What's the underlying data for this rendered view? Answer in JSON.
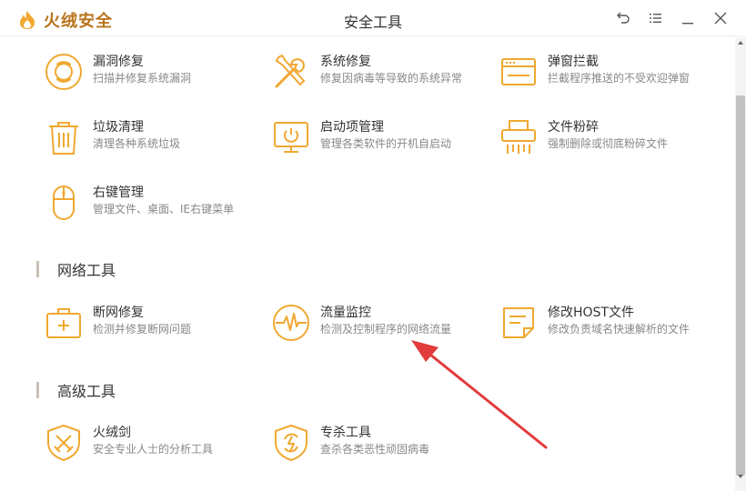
{
  "app": {
    "brand_name": "火绒安全",
    "window_title": "安全工具"
  },
  "colors": {
    "accent": "#f0a830",
    "brand": "#b8741a",
    "annotation_arrow": "#e23b3b"
  },
  "window_controls": [
    {
      "icon": "back-icon"
    },
    {
      "icon": "menu-icon"
    },
    {
      "icon": "minimize-icon"
    },
    {
      "icon": "close-icon"
    }
  ],
  "system_tools": [
    {
      "icon": "lifebuoy-icon",
      "name": "漏洞修复",
      "desc": "扫描并修复系统漏洞"
    },
    {
      "icon": "wrench-screwdriver-icon",
      "name": "系统修复",
      "desc": "修复因病毒等导致的系统异常"
    },
    {
      "icon": "popup-window-icon",
      "name": "弹窗拦截",
      "desc": "拦截程序推送的不受欢迎弹窗"
    },
    {
      "icon": "trash-icon",
      "name": "垃圾清理",
      "desc": "清理各种系统垃圾"
    },
    {
      "icon": "monitor-power-icon",
      "name": "启动项管理",
      "desc": "管理各类软件的开机自启动"
    },
    {
      "icon": "shredder-icon",
      "name": "文件粉碎",
      "desc": "强制删除或彻底粉碎文件"
    },
    {
      "icon": "mouse-icon",
      "name": "右键管理",
      "desc": "管理文件、桌面、IE右键菜单"
    }
  ],
  "network_section": {
    "title": "网络工具",
    "tools": [
      {
        "icon": "first-aid-kit-icon",
        "name": "断网修复",
        "desc": "检测并修复断网问题"
      },
      {
        "icon": "pulse-gauge-icon",
        "name": "流量监控",
        "desc": "检测及控制程序的网络流量"
      },
      {
        "icon": "document-edit-icon",
        "name": "修改HOST文件",
        "desc": "修改负责域名快速解析的文件"
      }
    ]
  },
  "advanced_section": {
    "title": "高级工具",
    "tools": [
      {
        "icon": "shield-sword-icon",
        "name": "火绒剑",
        "desc": "安全专业人士的分析工具"
      },
      {
        "icon": "shield-bolt-icon",
        "name": "专杀工具",
        "desc": "查杀各类恶性顽固病毒"
      }
    ]
  }
}
